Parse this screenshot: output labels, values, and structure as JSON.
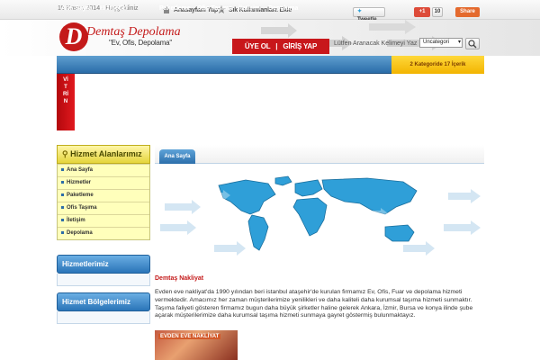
{
  "topbar": {
    "date": "15 Kasım 2014 - Hoşgeldiniz",
    "home_link": "Anasayfam Yap",
    "fav_link": "Sık Kullanılanlara Ekle",
    "tweet_label": "Tweetle",
    "gplus_label": "+1",
    "gplus_count": "10",
    "share_label": "Share"
  },
  "header": {
    "logo_letter": "D",
    "logo_name": "Demtaş Depolama",
    "logo_slogan": "\"Ev, Ofis, Depolama\"",
    "register_label": "ÜYE OL",
    "login_label": "GİRİŞ YAP",
    "search_placeholder": "Lütfen Aranacak Kelimeyi Yaz",
    "search_category": "Uncategori"
  },
  "nav": {
    "items": [
      "Ana Sayfa",
      "Hizmetler",
      "Paketleme",
      "Ofis Taşıma",
      "İletişim",
      "Depolama"
    ],
    "cart": "2 Kategoride 17 İçerik"
  },
  "vitrin": {
    "label": "VİTRİN"
  },
  "sidebar": {
    "services_title": "Hizmet Alanlarımız",
    "menu": [
      "Ana Sayfa",
      "Hizmetler",
      "Paketleme",
      "Ofis Taşıma",
      "İletişim",
      "Depolama"
    ],
    "box2_title": "Hizmetlerimiz",
    "box3_title": "Hizmet Bölgelerimiz"
  },
  "main": {
    "tab": "Ana Sayfa",
    "article_title": "Demtaş Nakliyat",
    "article_text": "Evden  eve nakliyat'da 1990 yılından beri istanbul ataşehir'de kurulan firmamız  Ev, Ofis, Fuar ve depolama hizmeti vermektedir. Amacımız her zaman müşterilerimize yenilikleri ve daha kaliteli daha kurumsal taşıma hizmeti sunmaktır.  Taşıma faliyeti gösteren firmamız bugun daha büyük şirketler haline gelerek Ankara, İzmir, Bursa ve konya ilinde şube açarak müşterilerimize daha kurumsal taşıma hizmeti sunmaya gayret göstermiş bulunmaktayız.",
    "photo_label": "EVDEN EVE NAKLİYAT"
  }
}
